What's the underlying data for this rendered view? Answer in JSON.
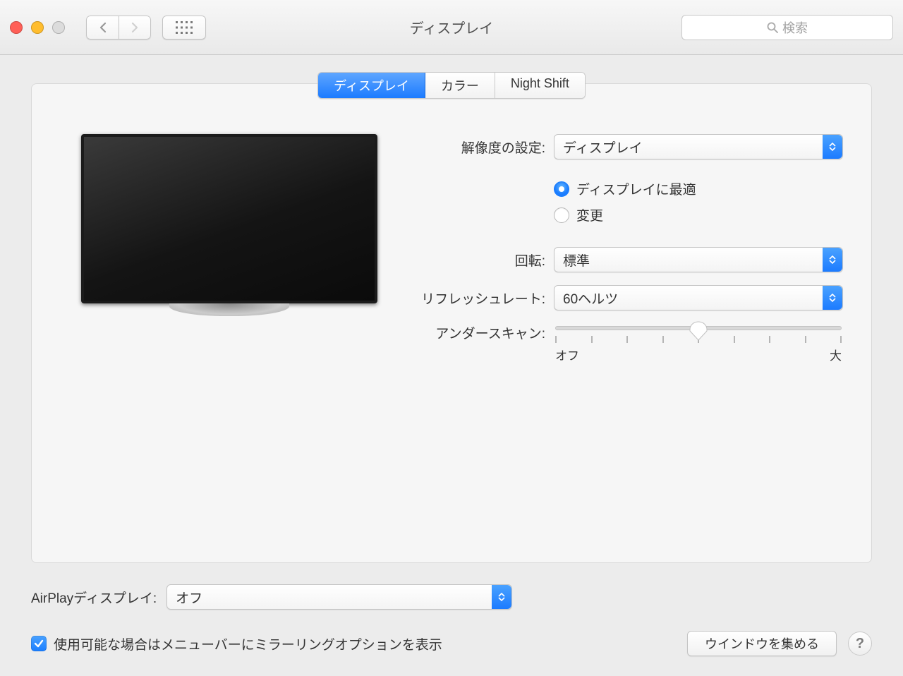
{
  "window": {
    "title": "ディスプレイ"
  },
  "search": {
    "placeholder": "検索"
  },
  "tabs": {
    "display": "ディスプレイ",
    "color": "カラー",
    "night_shift": "Night Shift"
  },
  "settings": {
    "resolution_setting_label": "解像度の設定:",
    "resolution_select_value": "ディスプレイ",
    "radio_best": "ディスプレイに最適",
    "radio_scaled": "変更",
    "rotation_label": "回転:",
    "rotation_value": "標準",
    "refresh_label": "リフレッシュレート:",
    "refresh_value": "60ヘルツ",
    "underscan_label": "アンダースキャン:",
    "underscan_min": "オフ",
    "underscan_max": "大"
  },
  "airplay": {
    "label": "AirPlayディスプレイ:",
    "value": "オフ"
  },
  "footer": {
    "checkbox_label": "使用可能な場合はメニューバーにミラーリングオプションを表示",
    "gather_button": "ウインドウを集める",
    "help": "?"
  }
}
